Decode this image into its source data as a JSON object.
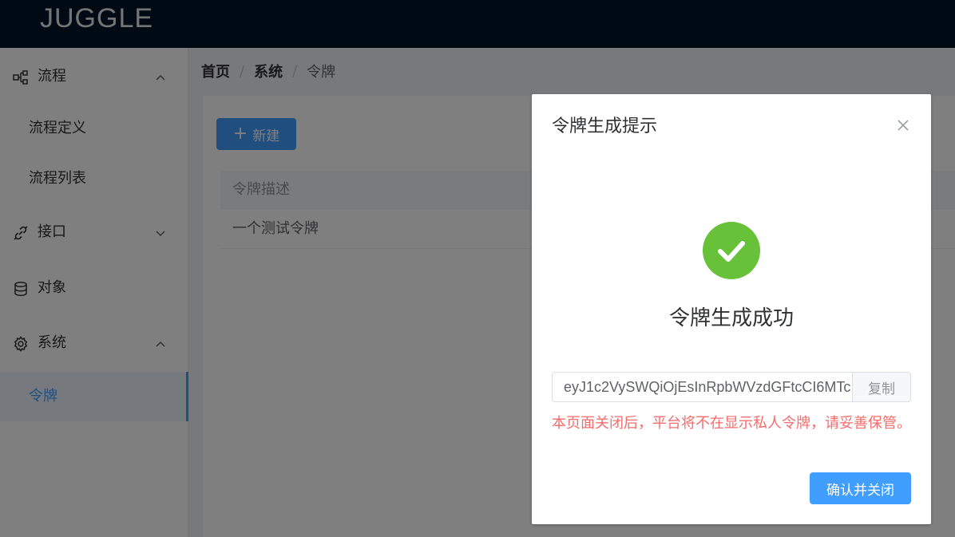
{
  "header": {
    "logo": "JUGGLE"
  },
  "sidebar": {
    "items": [
      {
        "label": "流程",
        "icon": "flow-chart-icon",
        "arrow": "chevron-up-icon"
      },
      {
        "label": "流程定义"
      },
      {
        "label": "流程列表"
      },
      {
        "label": "接口",
        "icon": "link-icon",
        "arrow": "chevron-down-icon"
      },
      {
        "label": "对象",
        "icon": "database-icon"
      },
      {
        "label": "系统",
        "icon": "gear-icon",
        "arrow": "chevron-up-icon"
      },
      {
        "label": "令牌",
        "active": true
      }
    ]
  },
  "breadcrumb": {
    "home": "首页",
    "system": "系统",
    "current": "令牌",
    "separator": "/"
  },
  "main": {
    "new_button": {
      "icon": "plus-icon",
      "label": "新建"
    },
    "table": {
      "columns": [
        "令牌描述"
      ],
      "rows": [
        [
          "一个测试令牌"
        ]
      ]
    }
  },
  "dialog": {
    "title": "令牌生成提示",
    "success_icon": "check-circle-icon",
    "success_text": "令牌生成成功",
    "token_value": "eyJ1c2VySWQiOjEsInRpbWVzdGFtcCI6MTc",
    "copy_label": "复制",
    "warning": "本页面关闭后，平台将不在显示私人令牌，请妥善保管。",
    "confirm_label": "确认并关闭"
  },
  "colors": {
    "primary": "#409eff",
    "success": "#67c23a",
    "danger": "#f56c6c",
    "header_bg": "#001529"
  }
}
